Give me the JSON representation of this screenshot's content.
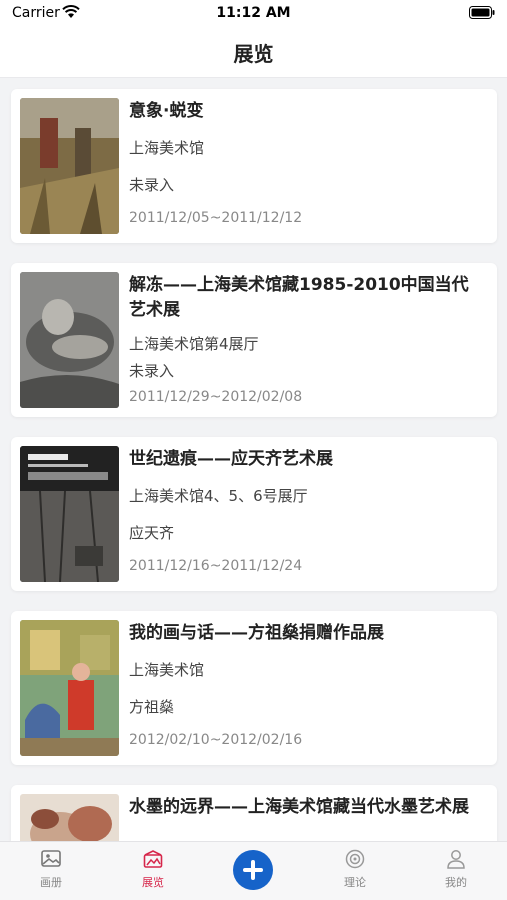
{
  "status": {
    "carrier": "Carrier",
    "time": "11:12 AM"
  },
  "nav": {
    "title": "展览"
  },
  "exhibitions": [
    {
      "title": "意象·蜕变",
      "venue": "上海美术馆",
      "artist": "未录入",
      "dates": "2011/12/05~2011/12/12"
    },
    {
      "title": "解冻——上海美术馆藏1985-2010中国当代艺术展",
      "venue": "上海美术馆第4展厅",
      "artist": "未录入",
      "dates": "2011/12/29~2012/02/08"
    },
    {
      "title": "世纪遗痕——应天齐艺术展",
      "venue": "上海美术馆4、5、6号展厅",
      "artist": "应天齐",
      "dates": "2011/12/16~2011/12/24"
    },
    {
      "title": "我的画与话——方祖燊捐赠作品展",
      "venue": "上海美术馆",
      "artist": "方祖燊",
      "dates": "2012/02/10~2012/02/16"
    },
    {
      "title": "水墨的远界——上海美术馆藏当代水墨艺术展"
    }
  ],
  "tabs": [
    {
      "label": "画册",
      "icon": "picture-icon"
    },
    {
      "label": "展览",
      "icon": "gallery-icon",
      "active": true
    },
    {
      "label": "",
      "icon": "plus-icon"
    },
    {
      "label": "理论",
      "icon": "target-icon"
    },
    {
      "label": "我的",
      "icon": "user-icon"
    }
  ],
  "colors": {
    "accent": "#d6264a",
    "add_button": "#1663c9"
  }
}
